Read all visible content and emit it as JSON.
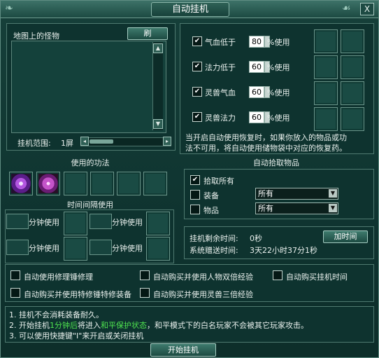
{
  "window": {
    "title": "自动挂机",
    "close_label": "X"
  },
  "monsters": {
    "title": "地图上的怪物",
    "refresh_label": "刷",
    "range_label": "挂机范围:",
    "range_value": "1屏"
  },
  "recovery": {
    "rows": [
      {
        "label": "气血低于",
        "value": "80",
        "unit": "%使用",
        "checked": true
      },
      {
        "label": "法力低于",
        "value": "60",
        "unit": "%使用",
        "checked": true
      },
      {
        "label": "灵兽气血",
        "value": "60",
        "unit": "%使用",
        "checked": true
      },
      {
        "label": "灵兽法力",
        "value": "60",
        "unit": "%使用",
        "checked": true
      }
    ],
    "note_line1": "当开启自动使用恢复时，如果你放入的物品或功",
    "note_line2": "法不可用，将自动使用储物袋中对应的恢复药。"
  },
  "skills": {
    "title": "使用的功法",
    "interval_title": "时间间隔使用",
    "minute_label": "分钟使用"
  },
  "pickup": {
    "title": "自动拾取物品",
    "all_label": "拾取所有",
    "all_checked": true,
    "equip_label": "装备",
    "equip_value": "所有",
    "item_label": "物品",
    "item_value": "所有"
  },
  "time": {
    "remaining_label": "挂机剩余时间:",
    "remaining_value": "0秒",
    "gift_label": "系统赠送时间:",
    "gift_value": "3天22小时37分1秒",
    "add_button": "加时间"
  },
  "options": {
    "repair": "自动使用修理锤修理",
    "double_exp": "自动购买并使用人物双倍经验",
    "buy_time": "自动购买挂机时间",
    "special_repair": "自动购买并使用特修锤特修装备",
    "pet_triple": "自动购买并使用灵兽三倍经验"
  },
  "notes": {
    "line1": "1. 挂机不会消耗装备耐久。",
    "line2_a": "2. 开始挂机",
    "line2_b": "1分钟后",
    "line2_c": "将进入",
    "line2_d": "和平保护状态",
    "line2_e": "，和平模式下的白名玩家不会被其它玩家攻击。",
    "line3": "3. 可以使用快捷键\"I\"来开启或关闭挂机"
  },
  "start_button": "开始挂机",
  "colors": {
    "accent_green": "#4fe44f",
    "frame": "#5f8c82"
  },
  "icons": [
    "close-icon",
    "refresh-icon",
    "scroll-up-icon",
    "scroll-down-icon",
    "scroll-left-icon",
    "scroll-right-icon",
    "dropdown-arrow-icon",
    "skill-icon"
  ]
}
